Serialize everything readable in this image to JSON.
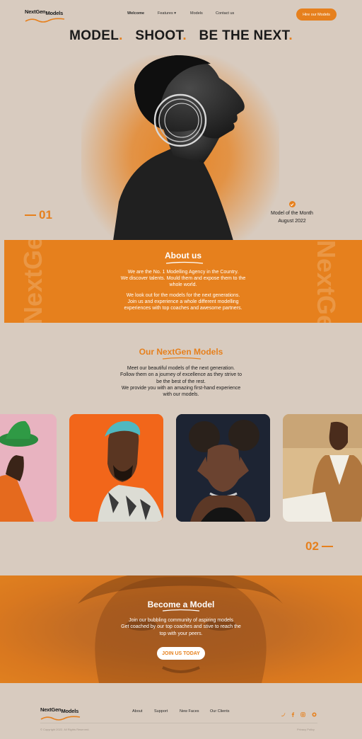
{
  "brand": {
    "line1": "NextGen",
    "line2": "Models",
    "accent": "#e6801d",
    "background": "#d8cbbf"
  },
  "nav": {
    "items": [
      {
        "label": "Welcome"
      },
      {
        "label": "Features"
      },
      {
        "label": "Models"
      },
      {
        "label": "Contact us"
      }
    ],
    "cta": "Hire our Models"
  },
  "hero": {
    "words": [
      "MODEL",
      "SHOOT",
      "BE THE NEXT"
    ],
    "dot": ".",
    "number": "01",
    "badge_title": "Model of the Month",
    "badge_date": "August 2022"
  },
  "about": {
    "title": "About us",
    "bg_word_left": "NextGen Models",
    "bg_word_right": "NextGen Models",
    "p1": [
      "We are the No. 1 Modelling Agency in the Country.",
      "We discover talents. Mould them and expose them to the",
      "whole world."
    ],
    "p2": [
      "We look out for the models for the next generations.",
      "Join us and experience a whole different modelling",
      "experiences with top coaches and awesome partners."
    ]
  },
  "models": {
    "title": "Our NextGen Models",
    "lines": [
      "Meet our beautiful models of the next generation.",
      "Follow them on a journey of excellence as they strive to",
      "be the best of the rest.",
      "We provide you with an amazing first-hand experience",
      "with our models."
    ],
    "number": "02"
  },
  "become": {
    "title": "Become a Model",
    "lines": [
      "Join our bubbling community of aspiring models",
      "Get coached by our top coaches and stive to reach the",
      "top with your peers."
    ],
    "cta": "JOIN US TODAY"
  },
  "footer": {
    "links": [
      {
        "label": "About"
      },
      {
        "label": "Support"
      },
      {
        "label": "New Faces"
      },
      {
        "label": "Our Clients"
      }
    ],
    "social_icons": [
      "twitter-icon",
      "facebook-icon",
      "instagram-icon",
      "github-icon"
    ],
    "copyright": "© Copyright 2022. All Rights Reserved.",
    "privacy": "Privacy Policy"
  }
}
